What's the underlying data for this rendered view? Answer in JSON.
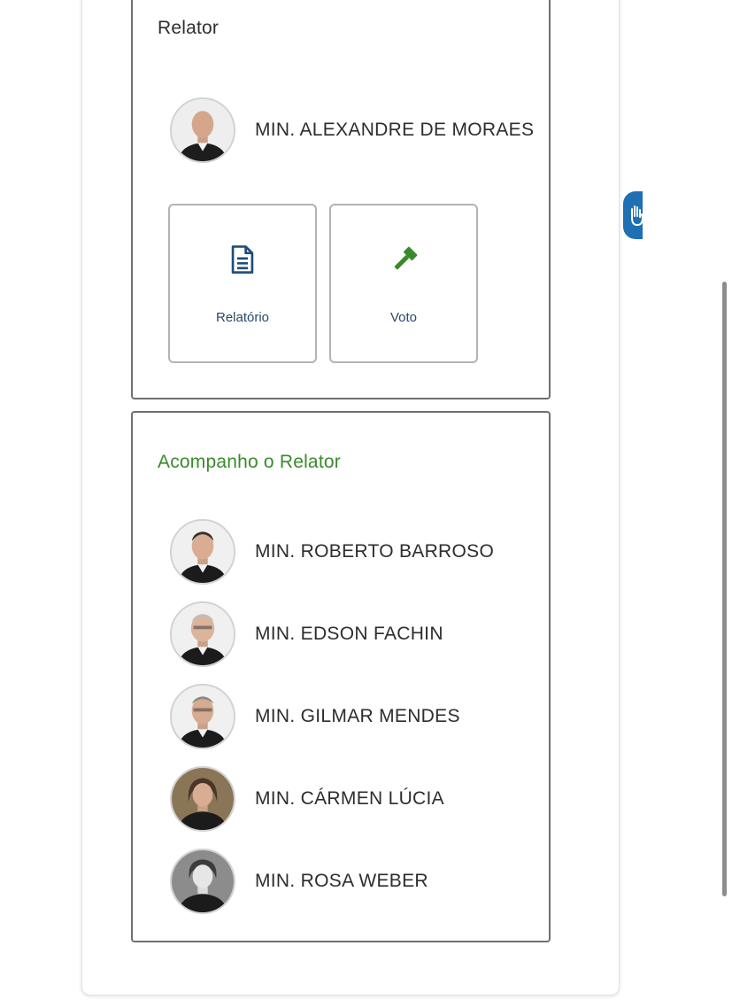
{
  "relator_section": {
    "title": "Relator",
    "minister": {
      "name": "MIN. ALEXANDRE DE MORAES",
      "avatar": "portrait-photo"
    },
    "documents": [
      {
        "label": "Relatório",
        "icon": "file-text-icon",
        "color": "#1f4e79"
      },
      {
        "label": "Voto",
        "icon": "gavel-icon",
        "color": "#3a8a2c"
      }
    ]
  },
  "follow_section": {
    "title": "Acompanho o Relator",
    "title_color": "#3a8a2c",
    "ministers": [
      {
        "name": "MIN. ROBERTO BARROSO",
        "avatar": "portrait-photo"
      },
      {
        "name": "MIN. EDSON FACHIN",
        "avatar": "portrait-photo"
      },
      {
        "name": "MIN. GILMAR MENDES",
        "avatar": "portrait-photo"
      },
      {
        "name": "MIN. CÁRMEN LÚCIA",
        "avatar": "portrait-photo"
      },
      {
        "name": "MIN. ROSA WEBER",
        "avatar": "portrait-photo"
      }
    ]
  },
  "accessibility_widget": {
    "icon": "hand-sign-icon",
    "color": "#1f6fb3"
  }
}
